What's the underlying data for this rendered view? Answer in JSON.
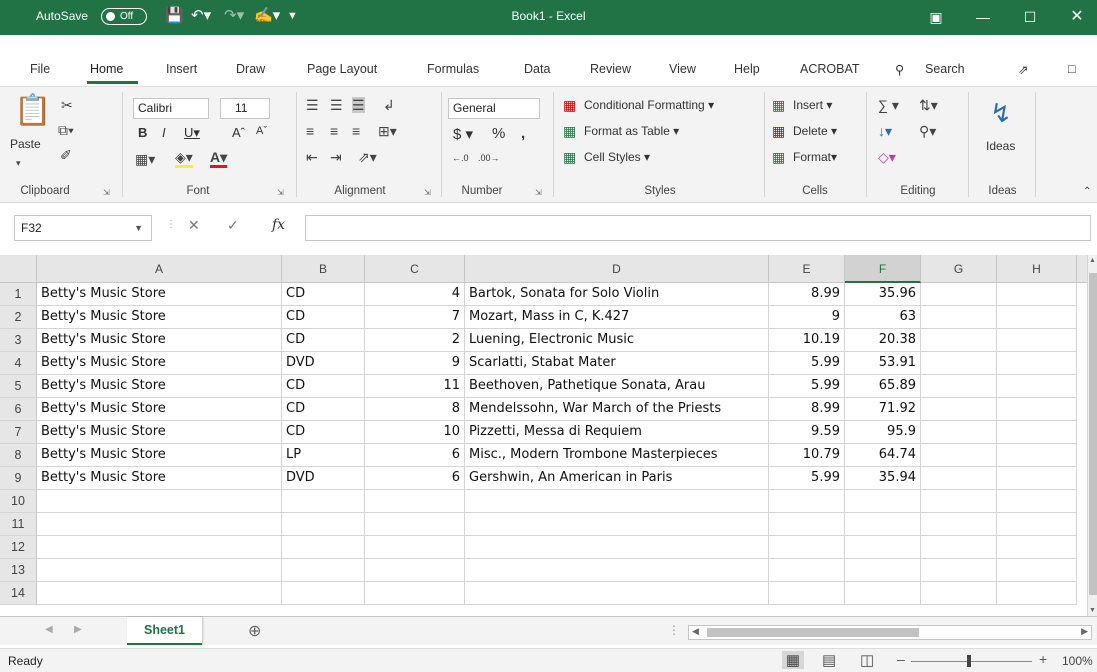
{
  "titlebar": {
    "autosave_label": "AutoSave",
    "autosave_state": "Off",
    "title": "Book1  -  Excel"
  },
  "tabs": [
    "File",
    "Home",
    "Insert",
    "Draw",
    "Page Layout",
    "Formulas",
    "Data",
    "Review",
    "View",
    "Help",
    "ACROBAT",
    "Search"
  ],
  "ribbon": {
    "paste": "Paste",
    "font_name": "Calibri",
    "font_size": "11",
    "number_format": "General",
    "conditional_formatting": "Conditional Formatting",
    "format_as_table": "Format as Table",
    "cell_styles": "Cell Styles",
    "insert": "Insert",
    "delete": "Delete",
    "format": "Format",
    "ideas": "Ideas",
    "groups": {
      "clipboard": "Clipboard",
      "font": "Font",
      "alignment": "Alignment",
      "number": "Number",
      "styles": "Styles",
      "cells": "Cells",
      "editing": "Editing",
      "ideas": "Ideas"
    }
  },
  "formula_bar": {
    "name_box": "F32",
    "fx": "fx",
    "content": ""
  },
  "grid": {
    "columns": [
      "A",
      "B",
      "C",
      "D",
      "E",
      "F",
      "G",
      "H"
    ],
    "selected_column": "F",
    "rows": [
      {
        "num": "1",
        "a": "Betty's Music Store",
        "b": "CD",
        "c": "4",
        "d": "Bartok, Sonata for Solo Violin",
        "e": "8.99",
        "f": "35.96"
      },
      {
        "num": "2",
        "a": "Betty's Music Store",
        "b": "CD",
        "c": "7",
        "d": "Mozart, Mass in C, K.427",
        "e": "9",
        "f": "63"
      },
      {
        "num": "3",
        "a": "Betty's Music Store",
        "b": "CD",
        "c": "2",
        "d": "Luening, Electronic Music",
        "e": "10.19",
        "f": "20.38"
      },
      {
        "num": "4",
        "a": "Betty's Music Store",
        "b": "DVD",
        "c": "9",
        "d": "Scarlatti, Stabat Mater",
        "e": "5.99",
        "f": "53.91"
      },
      {
        "num": "5",
        "a": "Betty's Music Store",
        "b": "CD",
        "c": "11",
        "d": "Beethoven, Pathetique Sonata, Arau",
        "e": "5.99",
        "f": "65.89"
      },
      {
        "num": "6",
        "a": "Betty's Music Store",
        "b": "CD",
        "c": "8",
        "d": "Mendelssohn, War March of the Priests",
        "e": "8.99",
        "f": "71.92"
      },
      {
        "num": "7",
        "a": "Betty's Music Store",
        "b": "CD",
        "c": "10",
        "d": "Pizzetti, Messa di Requiem",
        "e": "9.59",
        "f": "95.9"
      },
      {
        "num": "8",
        "a": "Betty's Music Store",
        "b": "LP",
        "c": "6",
        "d": "Misc., Modern Trombone Masterpieces",
        "e": "10.79",
        "f": "64.74"
      },
      {
        "num": "9",
        "a": "Betty's Music Store",
        "b": "DVD",
        "c": "6",
        "d": "Gershwin, An American in Paris",
        "e": "5.99",
        "f": "35.94"
      },
      {
        "num": "10",
        "a": "",
        "b": "",
        "c": "",
        "d": "",
        "e": "",
        "f": ""
      },
      {
        "num": "11",
        "a": "",
        "b": "",
        "c": "",
        "d": "",
        "e": "",
        "f": ""
      },
      {
        "num": "12",
        "a": "",
        "b": "",
        "c": "",
        "d": "",
        "e": "",
        "f": ""
      },
      {
        "num": "13",
        "a": "",
        "b": "",
        "c": "",
        "d": "",
        "e": "",
        "f": ""
      },
      {
        "num": "14",
        "a": "",
        "b": "",
        "c": "",
        "d": "",
        "e": "",
        "f": ""
      }
    ]
  },
  "sheets": [
    "Sheet1"
  ],
  "status": {
    "ready": "Ready",
    "zoom": "100%"
  }
}
